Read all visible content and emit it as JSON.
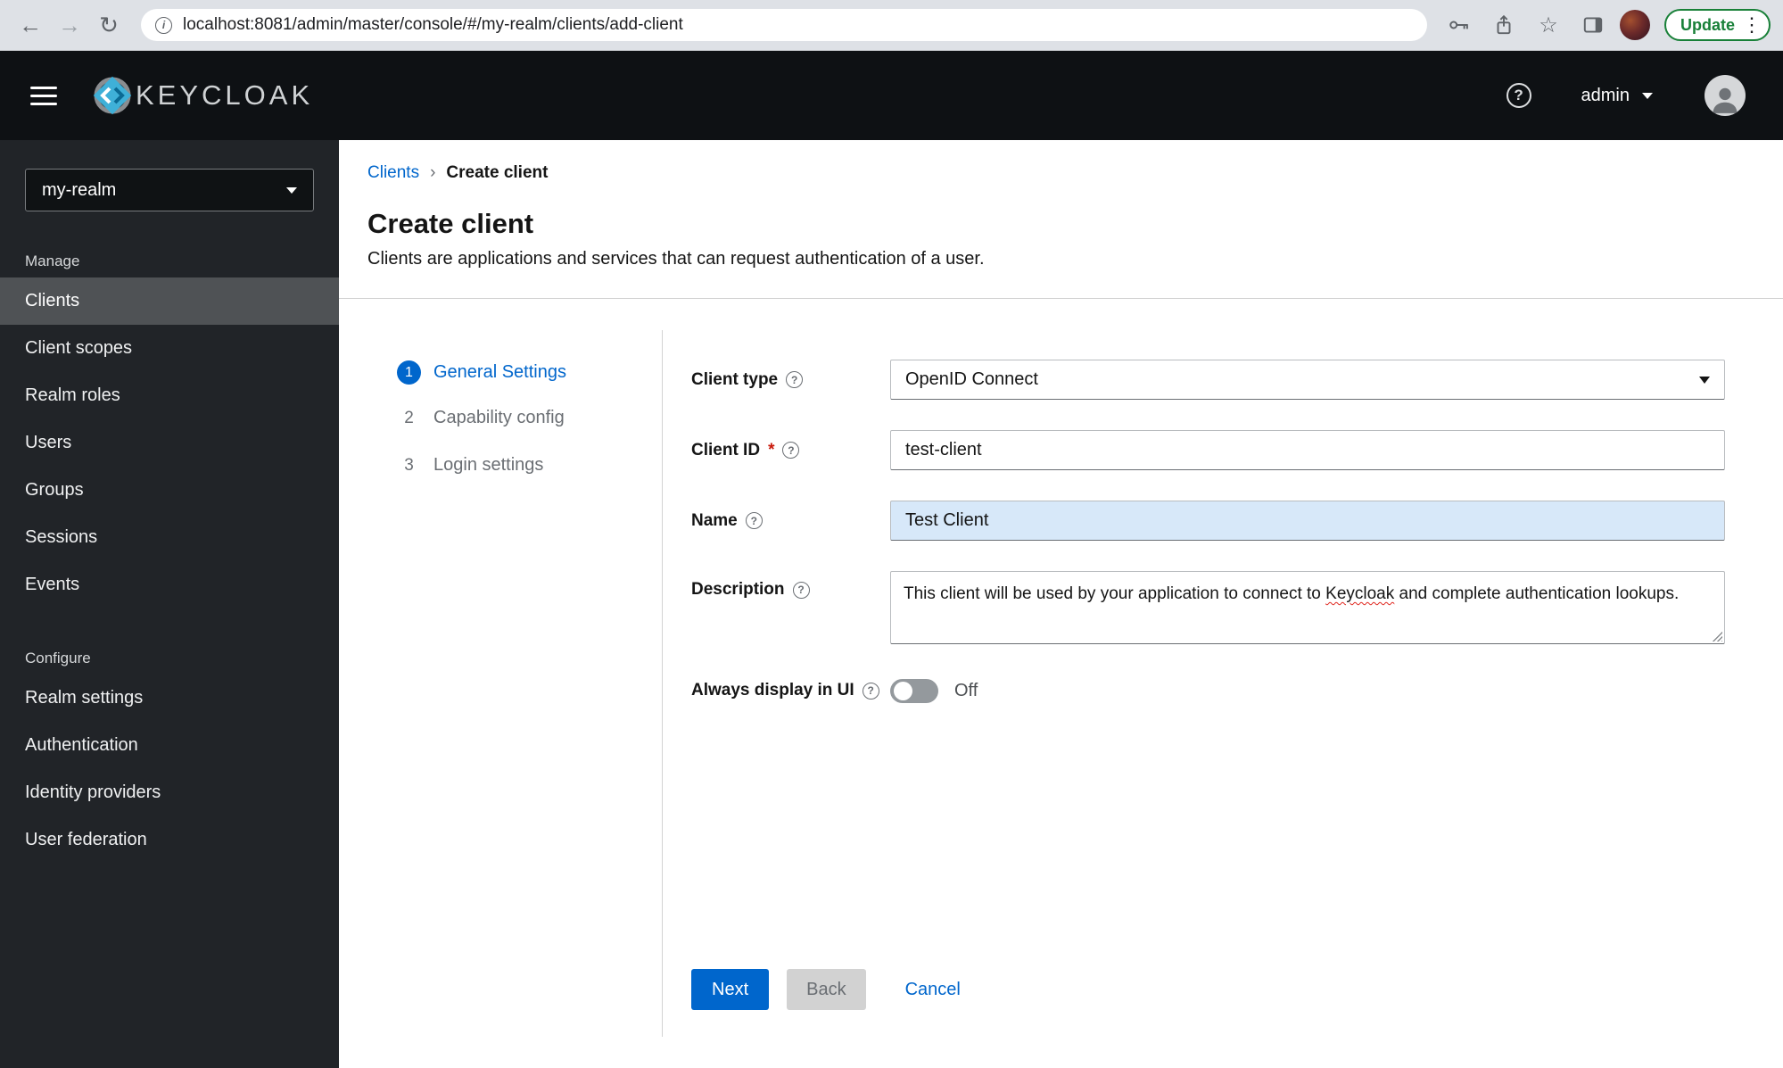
{
  "browser": {
    "url": "localhost:8081/admin/master/console/#/my-realm/clients/add-client",
    "update_label": "Update"
  },
  "icons": {
    "back": "←",
    "forward": "→",
    "reload": "↻",
    "info": "i",
    "star": "☆",
    "kebab": "⋮",
    "help": "?",
    "crumb_sep": "›"
  },
  "header": {
    "brand": "KEYCLOAK",
    "user": "admin"
  },
  "sidebar": {
    "realm": "my-realm",
    "manage_title": "Manage",
    "configure_title": "Configure",
    "manage_items": [
      "Clients",
      "Client scopes",
      "Realm roles",
      "Users",
      "Groups",
      "Sessions",
      "Events"
    ],
    "configure_items": [
      "Realm settings",
      "Authentication",
      "Identity providers",
      "User federation"
    ]
  },
  "main": {
    "breadcrumb": {
      "parent": "Clients",
      "current": "Create client"
    },
    "title": "Create client",
    "subtitle": "Clients are applications and services that can request authentication of a user.",
    "steps": [
      {
        "num": "1",
        "label": "General Settings"
      },
      {
        "num": "2",
        "label": "Capability config"
      },
      {
        "num": "3",
        "label": "Login settings"
      }
    ],
    "form": {
      "client_type": {
        "label": "Client type",
        "value": "OpenID Connect"
      },
      "client_id": {
        "label": "Client ID",
        "required": "*",
        "value": "test-client"
      },
      "name": {
        "label": "Name",
        "value": "Test Client"
      },
      "description": {
        "label": "Description",
        "value_pre": "This client will be used by your application to connect to ",
        "value_word": "Keycloak",
        "value_post": " and complete authentication lookups."
      },
      "always_display": {
        "label": "Always display in UI",
        "state": "Off"
      }
    },
    "actions": {
      "next": "Next",
      "back": "Back",
      "cancel": "Cancel"
    }
  }
}
